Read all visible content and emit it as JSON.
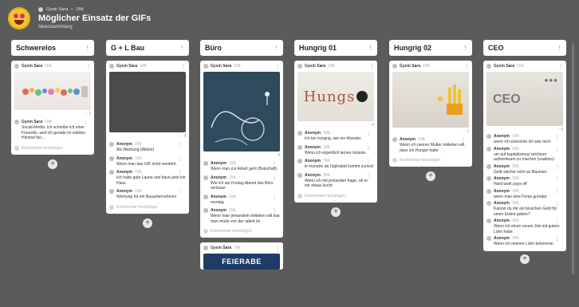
{
  "breadcrumb": {
    "owner": "Gysin Sara",
    "age": "1Mt."
  },
  "board": {
    "title": "Möglicher Einsatz der GIFs",
    "subtitle": "Ideensammlung"
  },
  "columns": [
    {
      "name": "Schwerelos",
      "cards": [
        {
          "author": "Gysin Sara",
          "time": "1Mt.",
          "image": "fish-drawing",
          "comment_count": "1",
          "comments": [
            {
              "author": "Gysin Sara",
              "time": "1Mt.",
              "text": "Social-Media: Ich schreibe ich einer Freundin, weil ich gerade im siebten Himmel bin..."
            }
          ],
          "add_comment": "Kommentar hinzufügen"
        }
      ]
    },
    {
      "name": "G + L Bau",
      "cards": [
        {
          "author": "Gysin Sara",
          "time": "1Mt.",
          "image": "dark-gray",
          "comment_count": "4",
          "comments": [
            {
              "author": "Anonym",
              "time": "1Mt.",
              "text": "Als Werbung (Aktion)"
            },
            {
              "author": "Anonym",
              "time": "1Mt.",
              "text": "Wenn man das GIF nicht versteht."
            },
            {
              "author": "Anonym",
              "time": "1Mt.",
              "text": "Ich habe gute Laune und baue jetzt ein Haus."
            },
            {
              "author": "Anonym",
              "time": "1Mt.",
              "text": "Werbung für ein Bauunternehmen"
            }
          ],
          "add_comment": "Kommentar hinzufügen"
        }
      ]
    },
    {
      "name": "Büro",
      "cards": [
        {
          "author": "Gysin Sara",
          "time": "1Mt.",
          "image": "chalkboard",
          "comment_count": "4",
          "comments": [
            {
              "author": "Anonym",
              "time": "1Mt.",
              "text": "Wenn man zur Arbeit geht (Botschaft)"
            },
            {
              "author": "Anonym",
              "time": "1Mt.",
              "text": "Wie ich am Freitag Abend das Büro verlasse"
            },
            {
              "author": "Anonym",
              "time": "1Mt.",
              "text": "montag"
            },
            {
              "author": "Anonym",
              "time": "1Mt.",
              "text": "Wenn man jemandem mitteilen will das man müde von der arbeit ist"
            }
          ],
          "add_comment": "Kommentar hinzufügen"
        },
        {
          "author": "Gysin Sara",
          "time": "1Mt.",
          "image": "feierabend",
          "image_text": "FEIERABE",
          "comment_count": "",
          "comments": [],
          "add_comment": ""
        }
      ]
    },
    {
      "name": "Hungrig 01",
      "cards": [
        {
          "author": "Gysin Sara",
          "time": "1Mt.",
          "image": "hungry-text",
          "image_text": "Hungs",
          "comment_count": "4",
          "comments": [
            {
              "author": "Anonym",
              "time": "1Mt.",
              "text": "Ich bin hungrig, wie ein Monster."
            },
            {
              "author": "Anonym",
              "time": "1Mt.",
              "text": "Wenn ich eigentlich lernen müsste."
            },
            {
              "author": "Anonym",
              "time": "1Mt.",
              "text": "le monstre de l'alphabet kommt zurück!"
            },
            {
              "author": "Anonym",
              "time": "1Mt.",
              "text": "Wenn ich mit jemanden frage, ob er mir etwas kocht"
            }
          ],
          "add_comment": "Kommentar hinzufügen"
        }
      ]
    },
    {
      "name": "Hungrig 02",
      "cards": [
        {
          "author": "Gysin Sara",
          "time": "1Mt.",
          "image": "fries",
          "comment_count": "1",
          "comments": [
            {
              "author": "Anonym",
              "time": "1Mt.",
              "text": "Wenn ich meiner Mutter mitteilen will, dass ich Hunger habe"
            }
          ],
          "add_comment": "Kommentar hinzufügen"
        }
      ]
    },
    {
      "name": "CEO",
      "cards": [
        {
          "author": "Gysin Sara",
          "time": "1Mt.",
          "image": "ceo-coins",
          "image_text": "CEO",
          "comment_count": "9",
          "comments": [
            {
              "author": "Anonym",
              "time": "1Mt.",
              "text": "wenn ich wünschte ich wär reich"
            },
            {
              "author": "Anonym",
              "time": "1Mt.",
              "text": "um auf kapitalismus/ reichtum aufmerksam zu machen (reaktion)"
            },
            {
              "author": "Anonym",
              "time": "1Mt.",
              "text": "Geld wächst nicht an Bäumen."
            },
            {
              "author": "Anonym",
              "time": "1Mt.",
              "text": "Hard work pays off"
            },
            {
              "author": "Anonym",
              "time": "1Mt.",
              "text": "wenn man eine Firma gründet"
            },
            {
              "author": "Anonym",
              "time": "1Mt.",
              "text": "Kannst du mir ein bisschen Geld für einen Eistee geben?"
            },
            {
              "author": "Anonym",
              "time": "1Mt.",
              "text": "Wenn ich einen neuen Job mit gutem Lohn habe."
            },
            {
              "author": "Anonym",
              "time": "1Mt.",
              "text": "Wenn ich meinen Lohn bekomme."
            }
          ],
          "add_comment": ""
        }
      ]
    }
  ],
  "add_post_label": "+",
  "colors": {
    "background": "#5b5b5b",
    "card": "#ffffff",
    "chalkboard": "#2e4a5c",
    "accent": "#f5c431"
  }
}
